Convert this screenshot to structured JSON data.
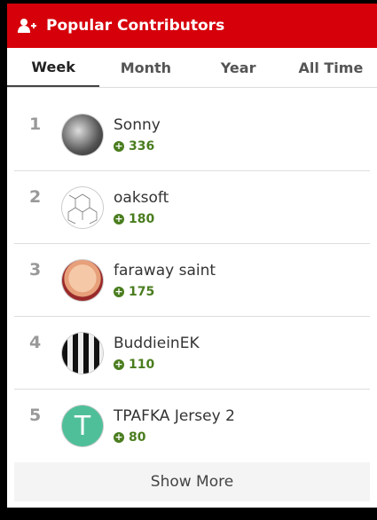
{
  "header": {
    "title": "Popular Contributors",
    "icon": "add-user-icon"
  },
  "tabs": [
    {
      "label": "Week",
      "active": true
    },
    {
      "label": "Month",
      "active": false
    },
    {
      "label": "Year",
      "active": false
    },
    {
      "label": "All Time",
      "active": false
    }
  ],
  "contributors": [
    {
      "rank": "1",
      "name": "Sonny",
      "score": "336"
    },
    {
      "rank": "2",
      "name": "oaksoft",
      "score": "180"
    },
    {
      "rank": "3",
      "name": "faraway saint",
      "score": "175"
    },
    {
      "rank": "4",
      "name": "BuddieinEK",
      "score": "110"
    },
    {
      "rank": "5",
      "name": "TPAFKA Jersey 2",
      "score": "80",
      "avatar_letter": "T"
    }
  ],
  "show_more": "Show More",
  "colors": {
    "header": "#d6000b",
    "score": "#4a7d1f",
    "avatar_t": "#4fbf9a"
  }
}
